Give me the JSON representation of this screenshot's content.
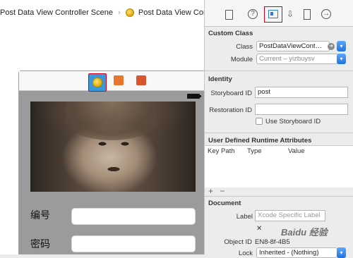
{
  "breadcrumb": {
    "scene": "Post Data View Controller Scene",
    "separator": "›",
    "controller": "Post Data View Controller"
  },
  "scene": {
    "form_fields": [
      {
        "label": "编号",
        "value": ""
      },
      {
        "label": "密码",
        "value": ""
      }
    ]
  },
  "inspector": {
    "tabs": {
      "help": "?",
      "attributes": "⇩",
      "connections": "→"
    },
    "custom_class": {
      "title": "Custom Class",
      "class_label": "Class",
      "class_value": "PostDataViewCont…",
      "module_label": "Module",
      "module_value": "Current – yizbuysv"
    },
    "identity": {
      "title": "Identity",
      "storyboard_id_label": "Storyboard ID",
      "storyboard_id_value": "post",
      "restoration_id_label": "Restoration ID",
      "restoration_id_value": "",
      "use_storyboard_id_label": "Use Storyboard ID",
      "use_storyboard_id_checked": false
    },
    "user_defined": {
      "title": "User Defined Runtime Attributes",
      "columns": [
        "Key Path",
        "Type",
        "Value"
      ],
      "add": "+",
      "remove": "−"
    },
    "document": {
      "title": "Document",
      "label_label": "Label",
      "label_placeholder": "Xcode Specific Label",
      "clear_symbol": "✕",
      "object_id_label": "Object ID",
      "object_id_value": "EN8-8f-4B5",
      "lock_label": "Lock",
      "lock_value": "Inherited - (Nothing)"
    }
  },
  "watermark": "Baidu 经验",
  "colors": {
    "selection_red": "#d0021b",
    "accent_blue": "#2c7bd6",
    "scene_bg": "#9b9b9b"
  }
}
